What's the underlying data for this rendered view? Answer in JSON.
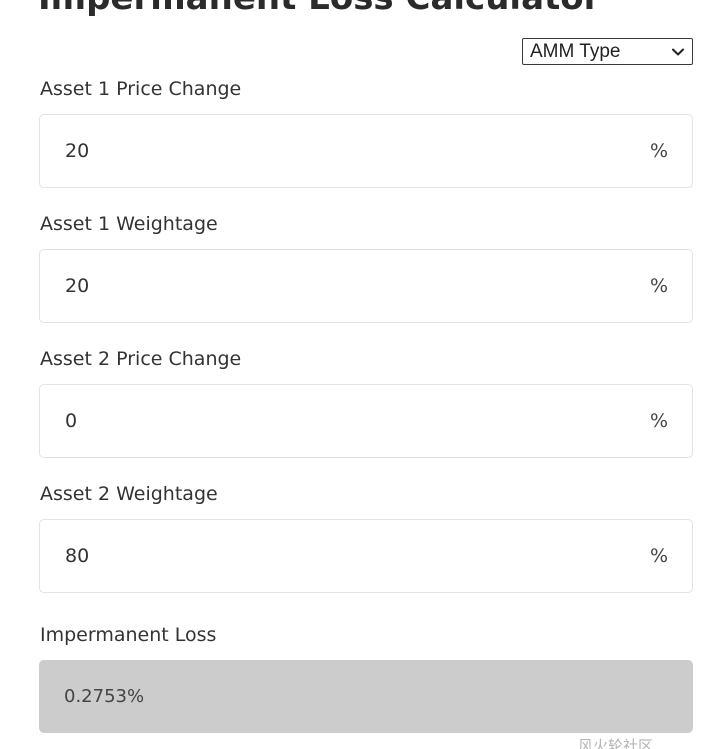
{
  "header": {
    "title": "Impermanent Loss Calculator"
  },
  "amm_select": {
    "selected": "AMM Type",
    "icon": "chevron-down-icon"
  },
  "fields": {
    "asset1_price": {
      "label": "Asset 1 Price Change",
      "value": "20",
      "unit": "%"
    },
    "asset1_weight": {
      "label": "Asset 1 Weightage",
      "value": "20",
      "unit": "%"
    },
    "asset2_price": {
      "label": "Asset 2 Price Change",
      "value": "0",
      "unit": "%"
    },
    "asset2_weight": {
      "label": "Asset 2 Weightage",
      "value": "80",
      "unit": "%"
    }
  },
  "result": {
    "label": "Impermanent Loss",
    "value": "0.2753%"
  },
  "watermark": {
    "text": "风火轮社区"
  },
  "colors": {
    "result_bg": "#cccccc",
    "field_border": "#e3e3e3",
    "text": "#333333"
  }
}
